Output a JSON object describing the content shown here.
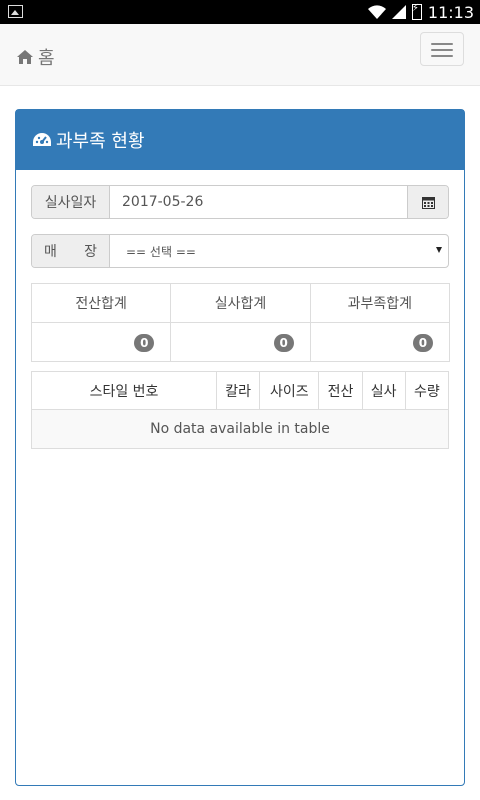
{
  "statusbar": {
    "time": "11:13"
  },
  "navbar": {
    "brand": "홈"
  },
  "panel": {
    "title": "과부족 현황",
    "date_label": "실사일자",
    "date_value": "2017-05-26",
    "store_label_1": "매",
    "store_label_2": "장",
    "store_selected": "== 선택 =="
  },
  "summary": {
    "headers": [
      "전산합계",
      "실사합계",
      "과부족합계"
    ],
    "values": [
      "0",
      "0",
      "0"
    ]
  },
  "table": {
    "columns": [
      "스타일 번호",
      "칼라",
      "사이즈",
      "전산",
      "실사",
      "수량"
    ],
    "empty_message": "No data available in table"
  }
}
